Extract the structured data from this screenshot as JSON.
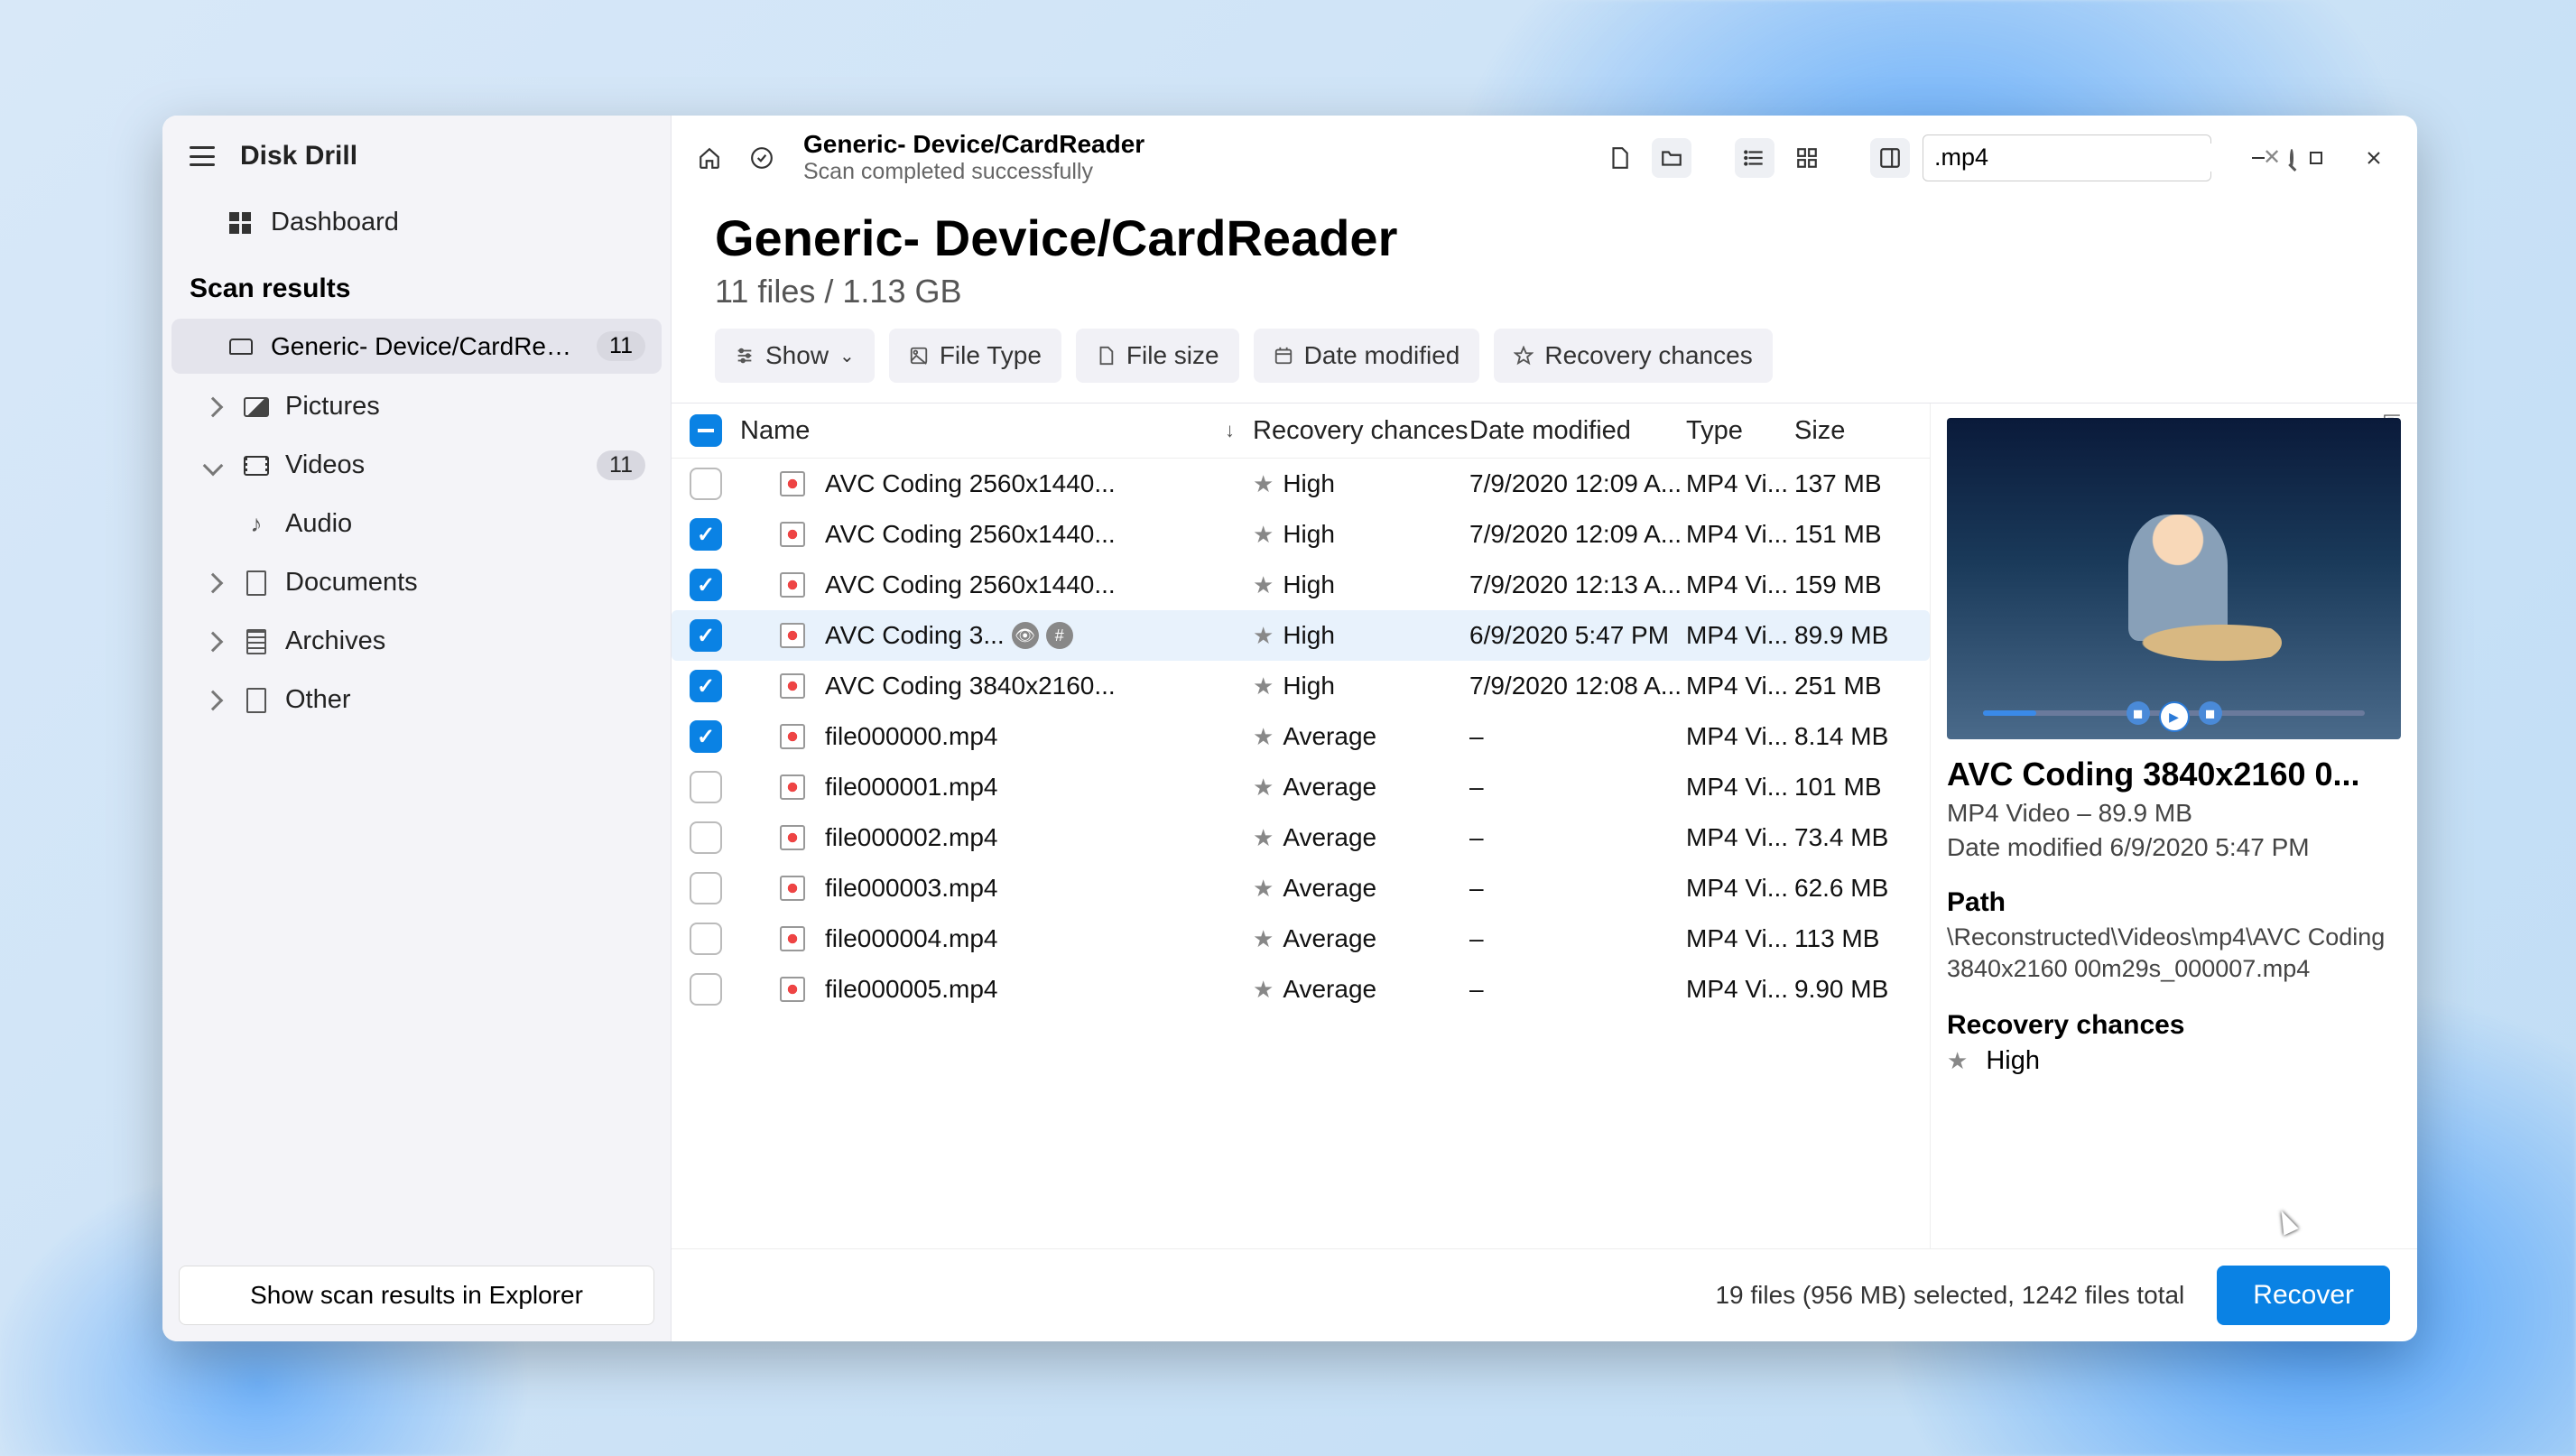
{
  "app_name": "Disk Drill",
  "sidebar": {
    "dashboard": "Dashboard",
    "scan_results_header": "Scan results",
    "device": {
      "label": "Generic- Device/CardRea...",
      "badge": "11"
    },
    "categories": [
      {
        "label": "Pictures",
        "icon": "picture-icon",
        "expandable": true,
        "open": false
      },
      {
        "label": "Videos",
        "icon": "video-icon",
        "expandable": true,
        "open": true,
        "badge": "11"
      },
      {
        "label": "Audio",
        "icon": "audio-icon",
        "expandable": false
      },
      {
        "label": "Documents",
        "icon": "document-icon",
        "expandable": true,
        "open": false
      },
      {
        "label": "Archives",
        "icon": "archive-icon",
        "expandable": true,
        "open": false
      },
      {
        "label": "Other",
        "icon": "other-icon",
        "expandable": true,
        "open": false
      }
    ],
    "bottom_button": "Show scan results in Explorer"
  },
  "topbar": {
    "title": "Generic- Device/CardReader",
    "subtitle": "Scan completed successfully",
    "search_value": ".mp4"
  },
  "header": {
    "title": "Generic- Device/CardReader",
    "subtitle": "11 files / 1.13 GB"
  },
  "filters": {
    "show": "Show",
    "file_type": "File Type",
    "file_size": "File size",
    "date_modified": "Date modified",
    "recovery_chances": "Recovery chances"
  },
  "columns": {
    "name": "Name",
    "recovery": "Recovery chances",
    "date": "Date modified",
    "type": "Type",
    "size": "Size"
  },
  "rows": [
    {
      "checked": false,
      "selected": false,
      "name": "AVC Coding 2560x1440...",
      "recovery": "High",
      "date": "7/9/2020 12:09 A...",
      "type": "MP4 Vi...",
      "size": "137 MB"
    },
    {
      "checked": true,
      "selected": false,
      "name": "AVC Coding 2560x1440...",
      "recovery": "High",
      "date": "7/9/2020 12:09 A...",
      "type": "MP4 Vi...",
      "size": "151 MB"
    },
    {
      "checked": true,
      "selected": false,
      "name": "AVC Coding 2560x1440...",
      "recovery": "High",
      "date": "7/9/2020 12:13 A...",
      "type": "MP4 Vi...",
      "size": "159 MB"
    },
    {
      "checked": true,
      "selected": true,
      "name": "AVC Coding 3...",
      "eye": true,
      "hash": true,
      "recovery": "High",
      "date": "6/9/2020 5:47 PM",
      "type": "MP4 Vi...",
      "size": "89.9 MB"
    },
    {
      "checked": true,
      "selected": false,
      "name": "AVC Coding 3840x2160...",
      "recovery": "High",
      "date": "7/9/2020 12:08 A...",
      "type": "MP4 Vi...",
      "size": "251 MB"
    },
    {
      "checked": true,
      "selected": false,
      "name": "file000000.mp4",
      "recovery": "Average",
      "date": "–",
      "type": "MP4 Vi...",
      "size": "8.14 MB"
    },
    {
      "checked": false,
      "selected": false,
      "name": "file000001.mp4",
      "recovery": "Average",
      "date": "–",
      "type": "MP4 Vi...",
      "size": "101 MB"
    },
    {
      "checked": false,
      "selected": false,
      "name": "file000002.mp4",
      "recovery": "Average",
      "date": "–",
      "type": "MP4 Vi...",
      "size": "73.4 MB"
    },
    {
      "checked": false,
      "selected": false,
      "name": "file000003.mp4",
      "recovery": "Average",
      "date": "–",
      "type": "MP4 Vi...",
      "size": "62.6 MB"
    },
    {
      "checked": false,
      "selected": false,
      "name": "file000004.mp4",
      "recovery": "Average",
      "date": "–",
      "type": "MP4 Vi...",
      "size": "113 MB"
    },
    {
      "checked": false,
      "selected": false,
      "name": "file000005.mp4",
      "recovery": "Average",
      "date": "–",
      "type": "MP4 Vi...",
      "size": "9.90 MB"
    }
  ],
  "preview": {
    "title": "AVC Coding 3840x2160 0...",
    "meta": "MP4 Video – 89.9 MB",
    "date": "Date modified 6/9/2020 5:47 PM",
    "path_label": "Path",
    "path": "\\Reconstructed\\Videos\\mp4\\AVC Coding 3840x2160 00m29s_000007.mp4",
    "recovery_label": "Recovery chances",
    "recovery": "High"
  },
  "footer": {
    "status": "19 files (956 MB) selected, 1242 files total",
    "recover": "Recover"
  }
}
